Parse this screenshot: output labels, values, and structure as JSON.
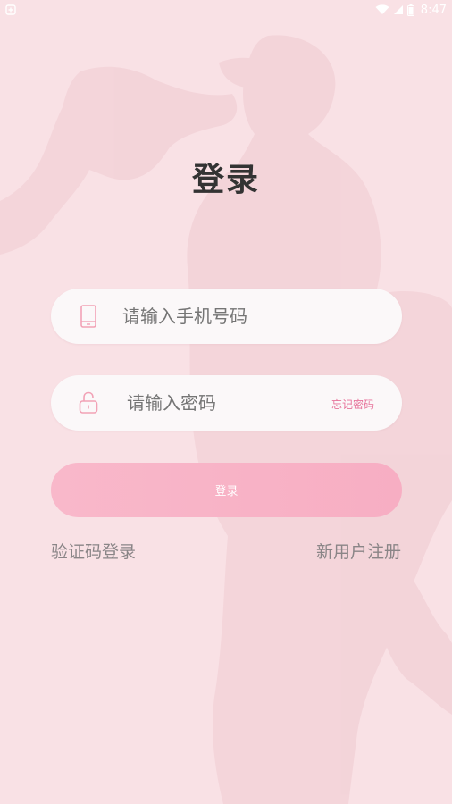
{
  "status_bar": {
    "time": "8:47",
    "icons": [
      "notification-icon",
      "wifi-icon",
      "signal-icon",
      "battery-icon"
    ]
  },
  "colors": {
    "background": "#f9e1e5",
    "accent": "#f7aec3",
    "link": "#e7729a",
    "title": "#333333"
  },
  "login": {
    "title": "登录",
    "phone": {
      "placeholder": "请输入手机号码",
      "value": "",
      "icon": "phone-icon"
    },
    "password": {
      "placeholder": "请输入密码",
      "value": "",
      "icon": "lock-icon",
      "forgot_label": "忘记密码"
    },
    "submit_label": "登录",
    "sms_login_label": "验证码登录",
    "register_label": "新用户注册"
  }
}
